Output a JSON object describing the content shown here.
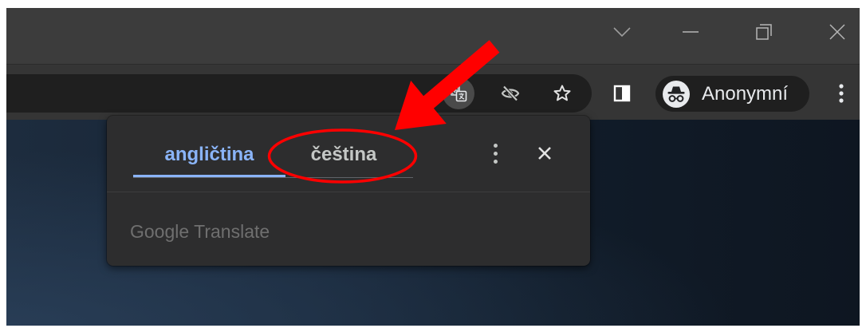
{
  "window_controls": {
    "tab_search_icon": "chevron-down-icon",
    "minimize_icon": "minimize-icon",
    "restore_icon": "restore-icon",
    "close_icon": "close-icon"
  },
  "toolbar": {
    "omnibox_icons": [
      "translate-icon",
      "eye-slash-icon",
      "star-icon"
    ],
    "translate_active": true,
    "side_panel_icon": "side-panel-icon",
    "profile": {
      "icon": "incognito-icon",
      "label": "Anonymní"
    },
    "menu_icon": "more-vert-icon"
  },
  "translate_bubble": {
    "tabs": [
      {
        "label": "angličtina",
        "selected": true
      },
      {
        "label": "čeština",
        "selected": false
      }
    ],
    "options_icon": "more-vert-icon",
    "close_icon": "close-icon",
    "footer_label": "Google Translate"
  },
  "colors": {
    "title_bar": "#3c3c3c",
    "toolbar": "#353535",
    "omnibox": "#1f1f1f",
    "profile_chip": "#1f1f1f",
    "bubble": "#2d2d2e",
    "accent": "#8ab4f8",
    "tab_text": "#c4c7c5",
    "footer_text": "#6f6f6f",
    "annotation_red": "#ff0000"
  }
}
